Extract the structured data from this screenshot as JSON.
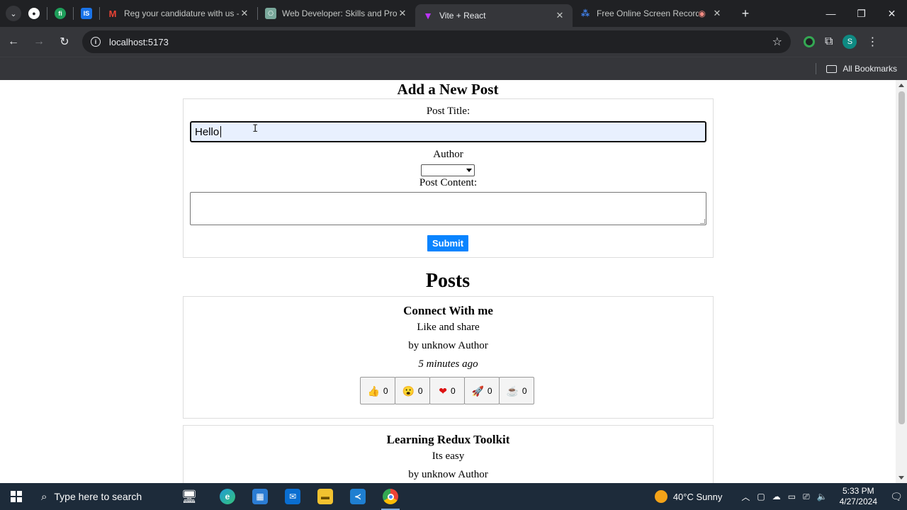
{
  "browser": {
    "tabs": [
      {
        "title": "Reg your candidature with us -",
        "icon": "gmail-icon",
        "active": false
      },
      {
        "title": "Web Developer: Skills and Proje",
        "icon": "chatgpt-icon",
        "active": false
      },
      {
        "title": "Vite + React",
        "icon": "vite-icon",
        "active": true
      },
      {
        "title": "Free Online Screen Recorder",
        "icon": "recorder-icon",
        "active": false
      }
    ],
    "pinned": [
      "github-icon",
      "fn-icon",
      "is-icon"
    ],
    "pinned_labels": {
      "fn": "fi",
      "is": "IS"
    },
    "url": "localhost:5173",
    "bookmarks_label": "All Bookmarks",
    "avatar_letter": "S"
  },
  "form": {
    "heading": "Add a New Post",
    "title_label": "Post Title:",
    "title_value": "Hello",
    "author_label": "Author",
    "author_selected": "",
    "content_label": "Post Content:",
    "content_value": "",
    "submit_label": "Submit"
  },
  "posts_heading": "Posts",
  "posts": [
    {
      "title": "Connect With me",
      "content": "Like and share",
      "author": "by unknow Author",
      "time": "5 minutes ago",
      "reactions": [
        {
          "icon": "thumbs-up-icon",
          "glyph": "👍",
          "count": "0"
        },
        {
          "icon": "wow-icon",
          "glyph": "😮",
          "count": "0"
        },
        {
          "icon": "heart-icon",
          "glyph": "❤",
          "count": "0"
        },
        {
          "icon": "rocket-icon",
          "glyph": "🚀",
          "count": "0"
        },
        {
          "icon": "coffee-icon",
          "glyph": "☕",
          "count": "0"
        }
      ]
    },
    {
      "title": "Learning Redux Toolkit",
      "content": "Its easy",
      "author": "by unknow Author"
    }
  ],
  "taskbar": {
    "search_placeholder": "Type here to search",
    "weather": "40°C  Sunny",
    "time": "5:33 PM",
    "date": "4/27/2024"
  },
  "colors": {
    "submit_bg": "#0a84ff",
    "input_bg": "#e8f0fe",
    "browser_dark": "#202124",
    "toolbar": "#35363a"
  }
}
